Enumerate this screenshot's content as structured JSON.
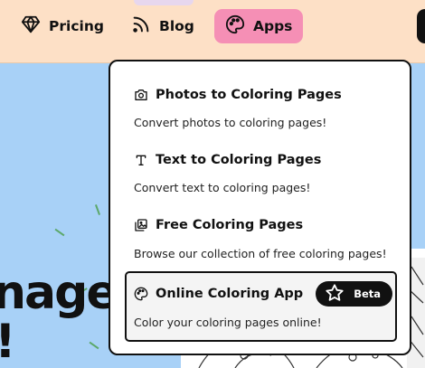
{
  "nav": {
    "items": [
      {
        "label": "Pricing",
        "icon": "diamond-icon"
      },
      {
        "label": "Blog",
        "icon": "rss-icon"
      },
      {
        "label": "Apps",
        "icon": "palette-icon"
      }
    ],
    "active_color": "#f58fb5",
    "bar_color": "#fde0c6"
  },
  "hero": {
    "text_line1": "nage",
    "text_line2": "!",
    "background_color": "#a8d1f7"
  },
  "dropdown": {
    "items": [
      {
        "title": "Photos to Coloring Pages",
        "description": "Convert photos to coloring pages!",
        "icon": "camera-icon"
      },
      {
        "title": "Text to Coloring Pages",
        "description": "Convert text to coloring pages!",
        "icon": "text-icon"
      },
      {
        "title": "Free Coloring Pages",
        "description": "Browse our collection of free coloring pages!",
        "icon": "images-icon"
      },
      {
        "title": "Online Coloring App",
        "description": "Color your coloring pages online!",
        "icon": "palette-icon",
        "badge": "Beta",
        "badge_icon": "star-icon"
      }
    ]
  }
}
